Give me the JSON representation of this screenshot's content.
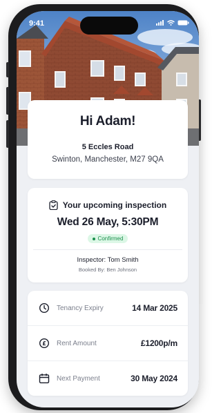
{
  "status_bar": {
    "time": "9:41"
  },
  "greeting": {
    "title": "Hi Adam!",
    "address_line1": "5 Eccles Road",
    "address_line2": "Swinton, Manchester, M27 9QA"
  },
  "inspection": {
    "heading": "Your upcoming inspection",
    "datetime": "Wed 26 May, 5:30PM",
    "status": "Confirmed",
    "inspector": "Inspector: Tom Smith",
    "booked_by": "Booked By: Ben Johnson"
  },
  "details": [
    {
      "icon": "clock-icon",
      "label": "Tenancy Expiry",
      "value": "14 Mar 2025"
    },
    {
      "icon": "pound-icon",
      "label": "Rent Amount",
      "value": "£1200p/m"
    },
    {
      "icon": "calendar-icon",
      "label": "Next Payment",
      "value": "30 May 2024"
    }
  ],
  "colors": {
    "accent_green": "#1b8f4c",
    "badge_bg": "#dcf7e6",
    "screen_bg": "#eef0f4",
    "text_dark": "#1b1e2b"
  }
}
